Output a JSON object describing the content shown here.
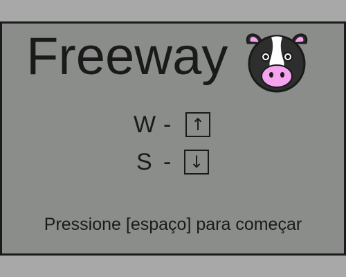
{
  "game": {
    "title": "Freeway",
    "mascot_icon": "cow-face-icon"
  },
  "controls": [
    {
      "key": "W",
      "separator": "-",
      "arrow": "↑"
    },
    {
      "key": "S",
      "separator": "-",
      "arrow": "↓"
    }
  ],
  "prompt": "Pressione [espaço] para começar",
  "colors": {
    "frame_bar": "#a8a8a8",
    "panel": "#8b8d8a",
    "ink": "#1a1a1a",
    "cow_nose": "#f5a3ef",
    "cow_white": "#ffffff",
    "cow_dark": "#2e2e2e"
  }
}
